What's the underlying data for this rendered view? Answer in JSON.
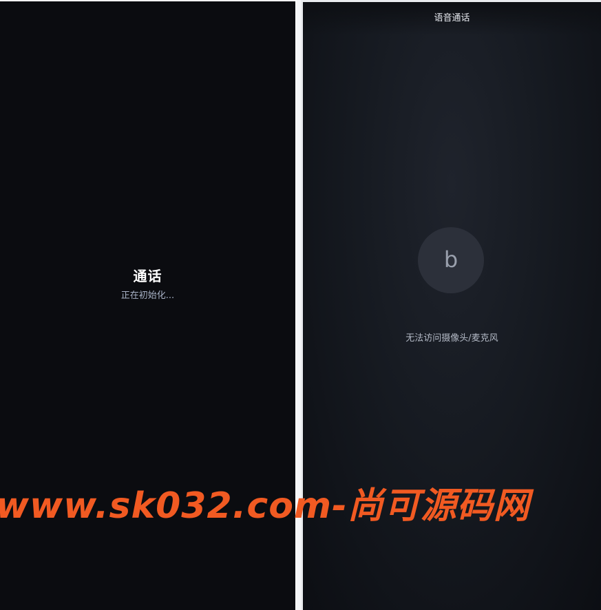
{
  "left_pane": {
    "title": "通话",
    "status": "正在初始化..."
  },
  "right_pane": {
    "header_title": "语音通话",
    "avatar_letter": "b",
    "status": "无法访问摄像头/麦克风"
  },
  "watermark": {
    "text": "www.sk032.com-尚可源码网",
    "color": "#f15a22"
  },
  "colors": {
    "background": "#0b0c10",
    "avatar_bg": "#2c303a",
    "status_text": "#b4bac6"
  }
}
